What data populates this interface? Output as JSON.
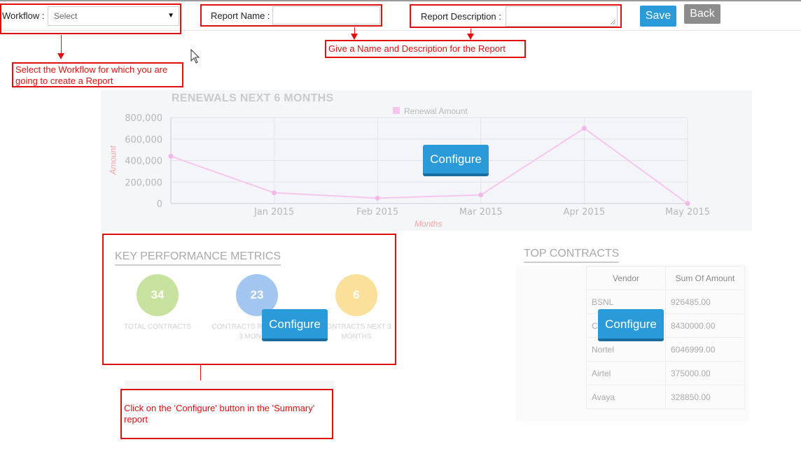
{
  "toolbar": {
    "workflow_label": "Workflow :",
    "workflow_value": "Select",
    "report_name_label": "Report Name :",
    "report_name_value": "",
    "report_description_label": "Report Description :",
    "report_description_value": "",
    "save_label": "Save",
    "back_label": "Back"
  },
  "callouts": {
    "workflow": "Select the Workflow for which you are going to create a Report",
    "name_description": "Give a Name and Description for the Report",
    "configure": "Click on the 'Configure' button in the 'Summary' report"
  },
  "renewals_chart": {
    "configure_label": "Configure"
  },
  "chart_data": {
    "type": "line",
    "title": "RENEWALS NEXT 6 MONTHS",
    "xlabel": "Months",
    "ylabel": "Amount",
    "categories": [
      "",
      "Jan 2015",
      "Feb 2015",
      "Mar 2015",
      "Apr 2015",
      "May 2015"
    ],
    "series": [
      {
        "name": "Renewal Amount",
        "values": [
          440000,
          100000,
          50000,
          80000,
          700000,
          0
        ]
      }
    ],
    "ylim": [
      0,
      800000
    ],
    "yticks": [
      "800,000",
      "600,000",
      "400,000",
      "200,000",
      "0"
    ],
    "grid": true,
    "legend": "top-center",
    "colors": {
      "line": "#f7c6ee",
      "point": "#f4b8e8"
    }
  },
  "kpi": {
    "title": "KEY PERFORMANCE METRICS",
    "configure_label": "Configure",
    "items": [
      {
        "value": "34",
        "label": "TOTAL CONTRACTS",
        "color": "#c7e29e"
      },
      {
        "value": "23",
        "label": "CONTRACTS RE... 3 MON...",
        "label_line1": "CONTRACTS RE",
        "label_line2": "3 MON",
        "color": "#a3c6f0"
      },
      {
        "value": "6",
        "label": "CONTRACTS NEXT 3 MONTHS",
        "label_line1": "CONTRACTS NEXT 3",
        "label_line2": "MONTHS",
        "color": "#fbe09c"
      }
    ]
  },
  "top_contracts": {
    "title": "TOP CONTRACTS",
    "configure_label": "Configure",
    "columns": [
      "Vendor",
      "Sum Of Amount"
    ],
    "rows": [
      [
        "BSNL",
        "926485.00"
      ],
      [
        "C",
        "8430000.00"
      ],
      [
        "Nortel",
        "6046999.00"
      ],
      [
        "Airtel",
        "375000.00"
      ],
      [
        "Avaya",
        "328850.00"
      ]
    ]
  },
  "colors": {
    "accent": "#2b9ad8",
    "annotation_red": "#e01010",
    "back_button": "#8c8c8c"
  }
}
